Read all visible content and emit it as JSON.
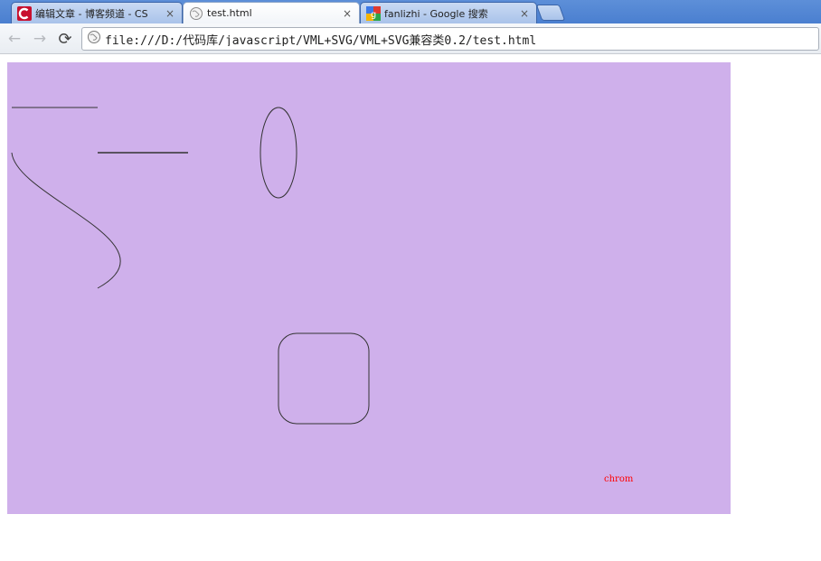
{
  "browser": {
    "tabs": [
      {
        "label": "编辑文章 - 博客频道 - CS",
        "favicon": "csdn-icon",
        "active": false
      },
      {
        "label": "test.html",
        "favicon": "globe-icon",
        "active": true
      },
      {
        "label": "fanlizhi - Google 搜索",
        "favicon": "google-icon",
        "active": false
      }
    ],
    "close_glyph": "×",
    "address": "file:///D:/代码库/javascript/VML+SVG/VML+SVG兼容类0.2/test.html",
    "back_glyph": "←",
    "forward_glyph": "→",
    "reload_glyph": "⟳"
  },
  "page": {
    "canvas_background": "#cfb0eb",
    "stroke_color": "#333333",
    "label": "chrom",
    "label_color": "#ff0000"
  }
}
